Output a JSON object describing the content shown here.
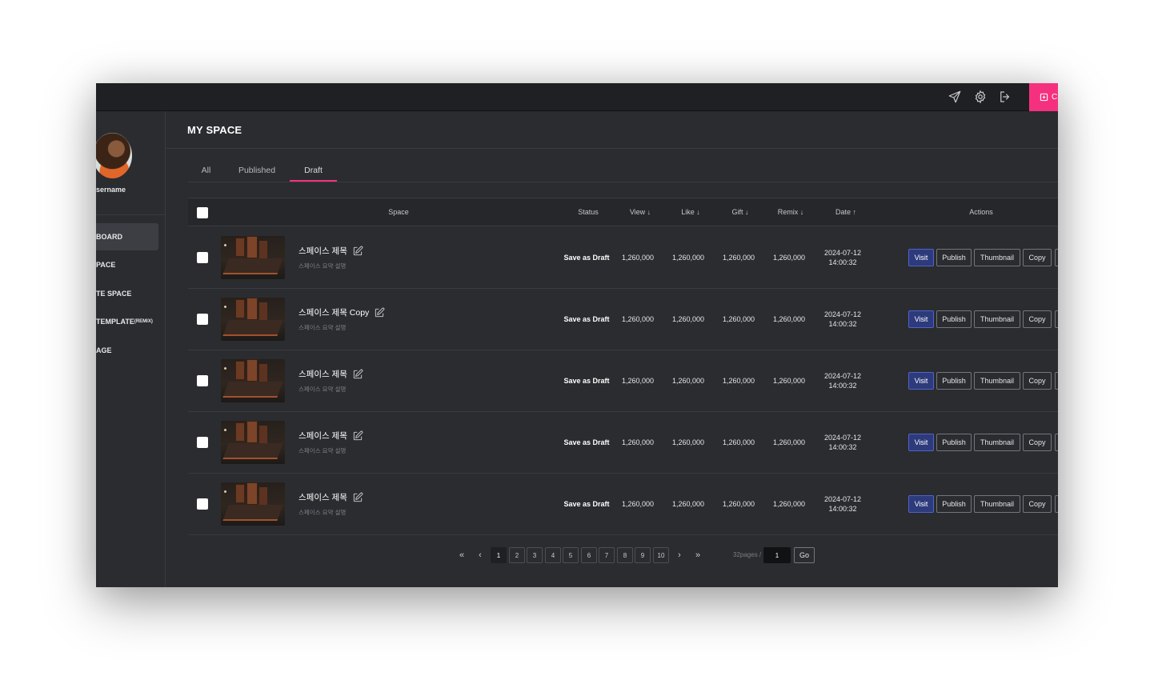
{
  "header": {
    "icons": [
      "send-icon",
      "gear-icon",
      "logout-icon"
    ],
    "create_button_label": "C",
    "accent_color": "#f5317f"
  },
  "sidebar": {
    "username": "sername",
    "items": [
      {
        "label": "BOARD",
        "active": true
      },
      {
        "label": "PACE"
      },
      {
        "label": "TE SPACE"
      },
      {
        "label": "TEMPLATE",
        "suffix": "(REMIX)"
      },
      {
        "label": "AGE"
      }
    ]
  },
  "page": {
    "title": "MY SPACE",
    "tabs": [
      {
        "label": "All"
      },
      {
        "label": "Published"
      },
      {
        "label": "Draft",
        "active": true
      }
    ]
  },
  "table": {
    "columns": {
      "space": "Space",
      "status": "Status",
      "view": "View ↓",
      "like": "Like ↓",
      "gift": "Gift ↓",
      "remix": "Remix ↓",
      "date": "Date ↑",
      "actions": "Actions"
    },
    "action_labels": {
      "visit": "Visit",
      "publish": "Publish",
      "thumbnail": "Thumbnail",
      "copy": "Copy"
    },
    "rows": [
      {
        "title": "스페이스 제목",
        "desc": "스페이스 요약 설명",
        "status": "Save as Draft",
        "view": "1,260,000",
        "like": "1,260,000",
        "gift": "1,260,000",
        "remix": "1,260,000",
        "date": "2024-07-12",
        "time": "14:00:32"
      },
      {
        "title": "스페이스 제목 Copy",
        "desc": "스페이스 요약 설명",
        "status": "Save as Draft",
        "view": "1,260,000",
        "like": "1,260,000",
        "gift": "1,260,000",
        "remix": "1,260,000",
        "date": "2024-07-12",
        "time": "14:00:32"
      },
      {
        "title": "스페이스 제목",
        "desc": "스페이스 요약 설명",
        "status": "Save as Draft",
        "view": "1,260,000",
        "like": "1,260,000",
        "gift": "1,260,000",
        "remix": "1,260,000",
        "date": "2024-07-12",
        "time": "14:00:32"
      },
      {
        "title": "스페이스 제목",
        "desc": "스페이스 요약 설명",
        "status": "Save as Draft",
        "view": "1,260,000",
        "like": "1,260,000",
        "gift": "1,260,000",
        "remix": "1,260,000",
        "date": "2024-07-12",
        "time": "14:00:32"
      },
      {
        "title": "스페이스 제목",
        "desc": "스페이스 요약 설명",
        "status": "Save as Draft",
        "view": "1,260,000",
        "like": "1,260,000",
        "gift": "1,260,000",
        "remix": "1,260,000",
        "date": "2024-07-12",
        "time": "14:00:32"
      }
    ]
  },
  "pagination": {
    "first": "«",
    "prev": "‹",
    "next": "›",
    "last": "»",
    "pages": [
      "1",
      "2",
      "3",
      "4",
      "5",
      "6",
      "7",
      "8",
      "9",
      "10"
    ],
    "current_page": "1",
    "total_label": "32pages /",
    "input_value": "1",
    "go_label": "Go"
  }
}
